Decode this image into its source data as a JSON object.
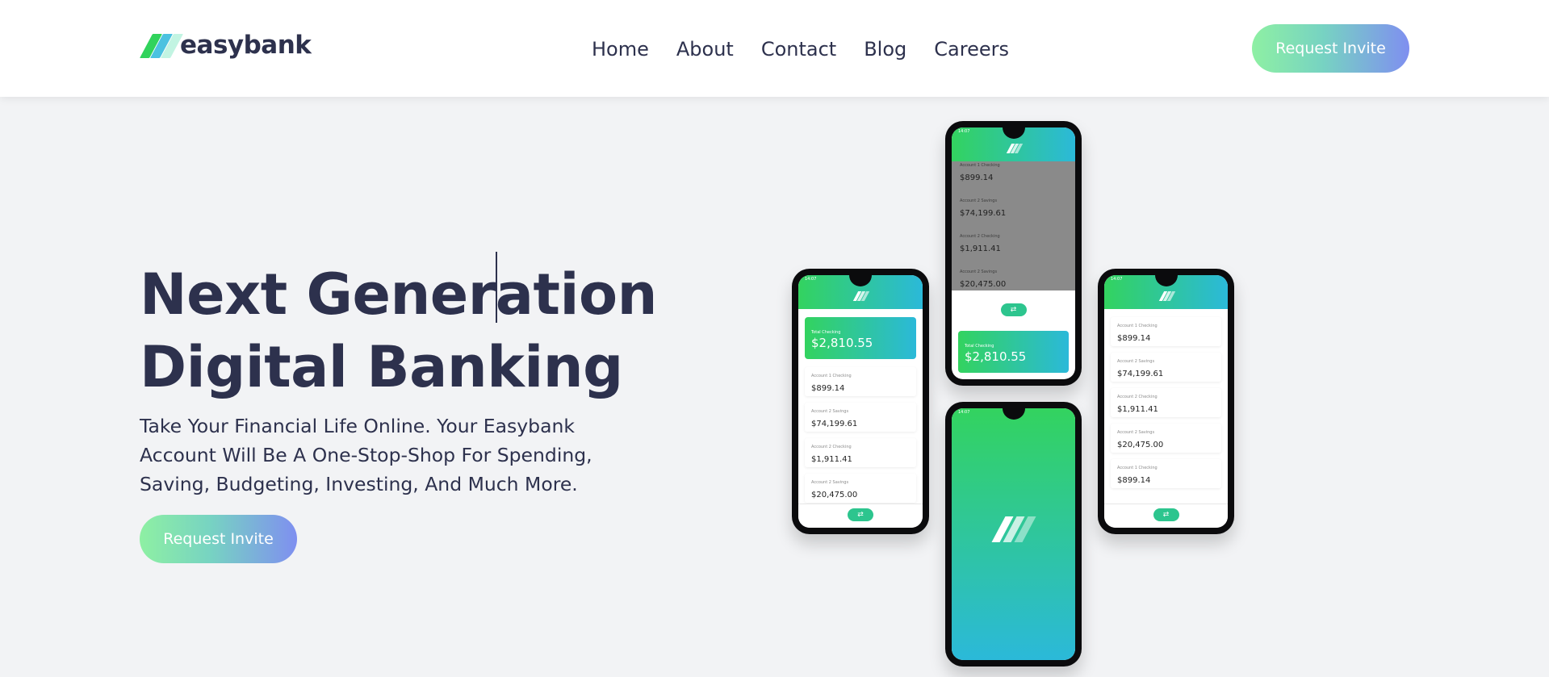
{
  "header": {
    "logo_text": "easybank",
    "nav": [
      "Home",
      "About",
      "Contact",
      "Blog",
      "Careers"
    ],
    "cta_label": "Request Invite"
  },
  "hero": {
    "title_line1": "Next Generation",
    "title_line2": "Digital Banking",
    "description": "Take Your Financial Life Online. Your Easybank Account Will Be A One-Stop-Shop For Spending, Saving, Budgeting, Investing, And Much More.",
    "cta_label": "Request Invite"
  },
  "phones": {
    "status_time": "14:07",
    "total_label": "Total Checking",
    "total_amount": "$2,810.55",
    "accounts": [
      {
        "label": "Account 1 Checking",
        "amount": "$899.14"
      },
      {
        "label": "Account 2 Savings",
        "amount": "$74,199.61"
      },
      {
        "label": "Account 2 Checking",
        "amount": "$1,911.41"
      },
      {
        "label": "Account 2 Savings",
        "amount": "$20,475.00"
      },
      {
        "label": "Account 1 Checking",
        "amount": "$899.14"
      }
    ]
  },
  "colors": {
    "brand_dark": "#2d314d",
    "brand_green": "#31d35c",
    "brand_cyan": "#2bb7da",
    "background": "#f2f3f5"
  }
}
